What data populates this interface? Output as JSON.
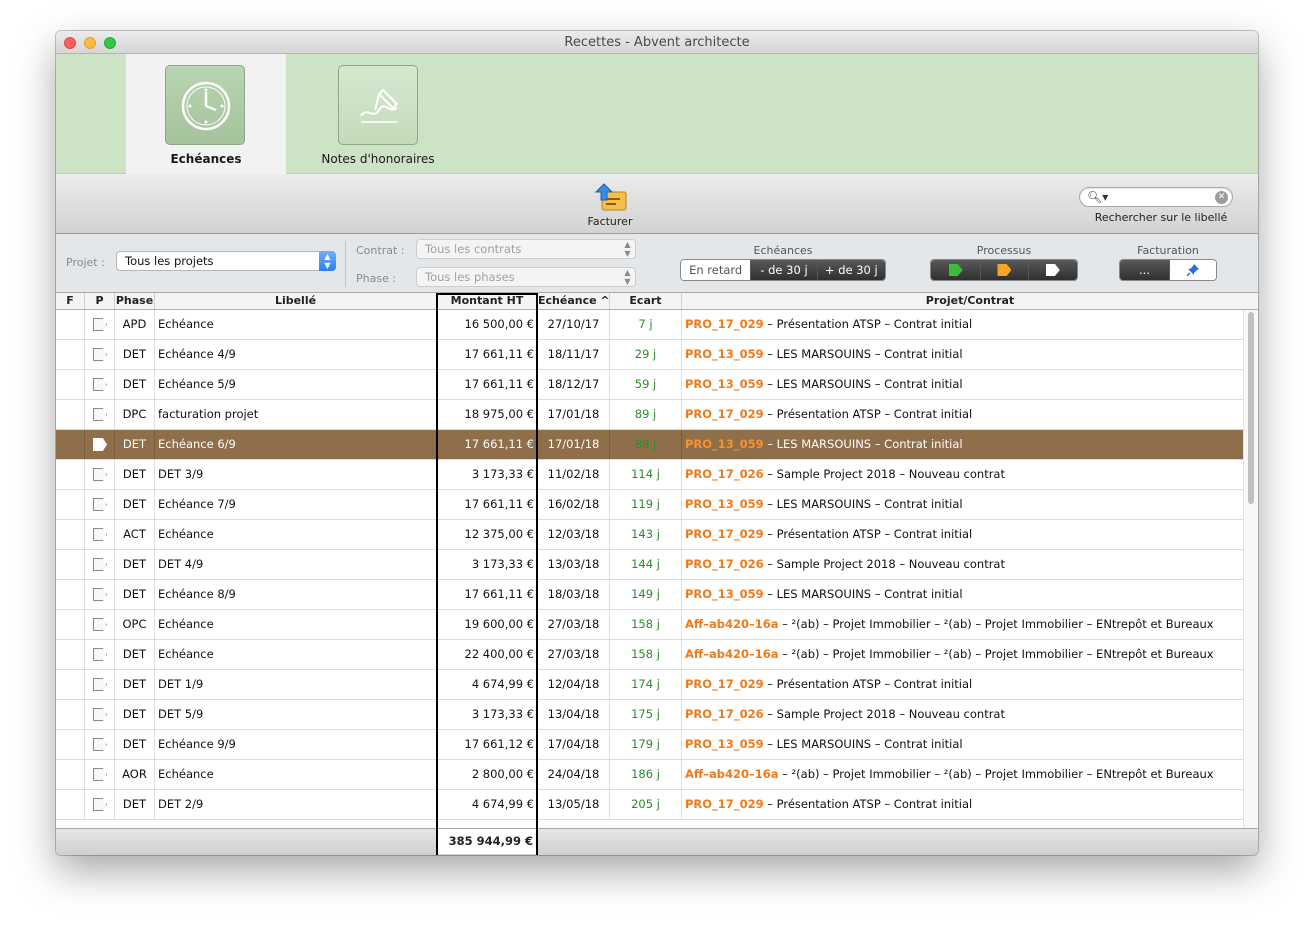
{
  "window": {
    "title": "Recettes - Abvent architecte"
  },
  "tabs": [
    {
      "label": "Echéances",
      "icon": "clock-icon"
    },
    {
      "label": "Notes d'honoraires",
      "icon": "signature-icon"
    }
  ],
  "toolbar": {
    "facturer_label": "Facturer",
    "search_label": "Rechercher sur le libellé",
    "search_value": ""
  },
  "filters": {
    "projet_label": "Projet :",
    "projet_value": "Tous les projets",
    "contrat_label": "Contrat :",
    "contrat_value": "Tous les contrats",
    "phase_label": "Phase :",
    "phase_value": "Tous les phases",
    "echeances_title": "Echéances",
    "echeances_options": [
      "En retard",
      "- de 30 j",
      "+ de 30 j"
    ],
    "processus_title": "Processus",
    "processus_colors": [
      "#3dbb3d",
      "#f5a623",
      "#ffffff"
    ],
    "facturation_title": "Facturation",
    "facturation_options": [
      "...",
      "pin-icon"
    ]
  },
  "table": {
    "columns": [
      "F",
      "P",
      "Phase",
      "Libellé",
      "Montant HT",
      "Echéance",
      "Ecart",
      "Projet/Contrat"
    ],
    "selected_index": 4,
    "rows": [
      {
        "phase": "APD",
        "libelle": "Echéance",
        "montant": "16 500,00 €",
        "echeance": "27/10/17",
        "ecart": "7 j",
        "code": "PRO_17_029",
        "desc": " – Présentation ATSP – Contrat initial"
      },
      {
        "phase": "DET",
        "libelle": "Echéance 4/9",
        "montant": "17 661,11 €",
        "echeance": "18/11/17",
        "ecart": "29 j",
        "code": "PRO_13_059",
        "desc": " – LES MARSOUINS – Contrat initial"
      },
      {
        "phase": "DET",
        "libelle": "Echéance 5/9",
        "montant": "17 661,11 €",
        "echeance": "18/12/17",
        "ecart": "59 j",
        "code": "PRO_13_059",
        "desc": " – LES MARSOUINS – Contrat initial"
      },
      {
        "phase": "DPC",
        "libelle": "facturation projet",
        "montant": "18 975,00 €",
        "echeance": "17/01/18",
        "ecart": "89 j",
        "code": "PRO_17_029",
        "desc": " – Présentation ATSP – Contrat initial"
      },
      {
        "phase": "DET",
        "libelle": "Echéance 6/9",
        "montant": "17 661,11 €",
        "echeance": "17/01/18",
        "ecart": "89 j",
        "code": "PRO_13_059",
        "desc": " – LES MARSOUINS – Contrat initial"
      },
      {
        "phase": "DET",
        "libelle": "DET 3/9",
        "montant": "3 173,33 €",
        "echeance": "11/02/18",
        "ecart": "114 j",
        "code": "PRO_17_026",
        "desc": " – Sample Project 2018 – Nouveau contrat"
      },
      {
        "phase": "DET",
        "libelle": "Echéance 7/9",
        "montant": "17 661,11 €",
        "echeance": "16/02/18",
        "ecart": "119 j",
        "code": "PRO_13_059",
        "desc": " – LES MARSOUINS – Contrat initial"
      },
      {
        "phase": "ACT",
        "libelle": "Echéance",
        "montant": "12 375,00 €",
        "echeance": "12/03/18",
        "ecart": "143 j",
        "code": "PRO_17_029",
        "desc": " – Présentation ATSP – Contrat initial"
      },
      {
        "phase": "DET",
        "libelle": "DET 4/9",
        "montant": "3 173,33 €",
        "echeance": "13/03/18",
        "ecart": "144 j",
        "code": "PRO_17_026",
        "desc": " – Sample Project 2018 – Nouveau contrat"
      },
      {
        "phase": "DET",
        "libelle": "Echéance 8/9",
        "montant": "17 661,11 €",
        "echeance": "18/03/18",
        "ecart": "149 j",
        "code": "PRO_13_059",
        "desc": " – LES MARSOUINS – Contrat initial"
      },
      {
        "phase": "OPC",
        "libelle": "Echéance",
        "montant": "19 600,00 €",
        "echeance": "27/03/18",
        "ecart": "158 j",
        "code": "Aff–ab420–16a",
        "desc": " – ²(ab) – Projet Immobilier – ²(ab) – Projet Immobilier – ENtrepôt et Bureaux"
      },
      {
        "phase": "DET",
        "libelle": "Echéance",
        "montant": "22 400,00 €",
        "echeance": "27/03/18",
        "ecart": "158 j",
        "code": "Aff–ab420–16a",
        "desc": " – ²(ab) – Projet Immobilier – ²(ab) – Projet Immobilier – ENtrepôt et Bureaux"
      },
      {
        "phase": "DET",
        "libelle": "DET 1/9",
        "montant": "4 674,99 €",
        "echeance": "12/04/18",
        "ecart": "174 j",
        "code": "PRO_17_029",
        "desc": " – Présentation ATSP – Contrat initial"
      },
      {
        "phase": "DET",
        "libelle": "DET 5/9",
        "montant": "3 173,33 €",
        "echeance": "13/04/18",
        "ecart": "175 j",
        "code": "PRO_17_026",
        "desc": " – Sample Project 2018 – Nouveau contrat"
      },
      {
        "phase": "DET",
        "libelle": "Echéance 9/9",
        "montant": "17 661,12 €",
        "echeance": "17/04/18",
        "ecart": "179 j",
        "code": "PRO_13_059",
        "desc": " – LES MARSOUINS – Contrat initial"
      },
      {
        "phase": "AOR",
        "libelle": "Echéance",
        "montant": "2 800,00 €",
        "echeance": "24/04/18",
        "ecart": "186 j",
        "code": "Aff–ab420–16a",
        "desc": " – ²(ab) – Projet Immobilier – ²(ab) – Projet Immobilier – ENtrepôt et Bureaux"
      },
      {
        "phase": "DET",
        "libelle": "DET 2/9",
        "montant": "4 674,99 €",
        "echeance": "13/05/18",
        "ecart": "205 j",
        "code": "PRO_17_029",
        "desc": " – Présentation ATSP – Contrat initial"
      }
    ],
    "total": "385 944,99 €"
  }
}
